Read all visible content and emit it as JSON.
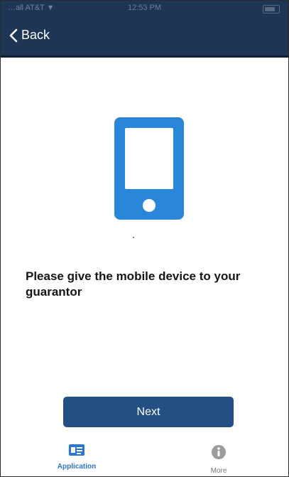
{
  "status_bar": {
    "carrier": "…all AT&T ▼",
    "time": "12:53 PM"
  },
  "nav": {
    "back_label": "Back"
  },
  "main": {
    "instruction": "Please give the mobile device to your guarantor",
    "next_label": "Next"
  },
  "tabs": [
    {
      "label": "Application",
      "icon": "id-card-icon",
      "active": true
    },
    {
      "label": "More",
      "icon": "info-icon",
      "active": false
    }
  ],
  "colors": {
    "nav_background": "#1f3556",
    "accent": "#2b76d2",
    "button": "#234f82"
  }
}
